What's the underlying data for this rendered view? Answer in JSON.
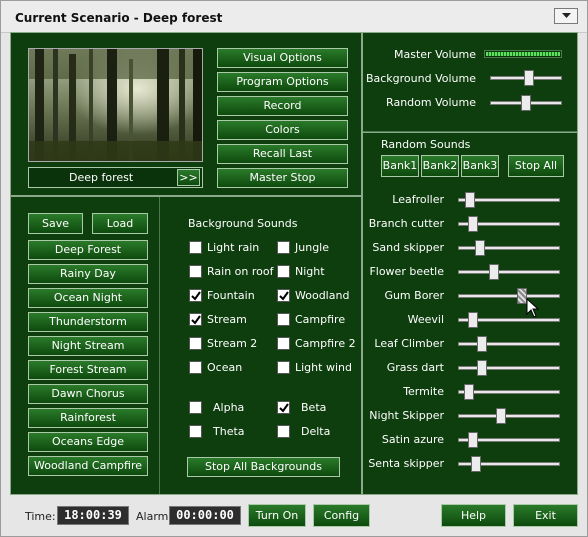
{
  "title": "Current Scenario - Deep forest",
  "scene": {
    "name": "Deep forest",
    "next_label": ">>"
  },
  "option_buttons": [
    "Visual Options",
    "Program Options",
    "Record",
    "Colors",
    "Recall Last",
    "Master Stop"
  ],
  "volume": {
    "master_label": "Master Volume",
    "master_level": 1.0,
    "background_label": "Background Volume",
    "background_level": 0.55,
    "random_label": "Random Volume",
    "random_level": 0.5
  },
  "random_sounds": {
    "heading": "Random Sounds",
    "banks": [
      "Bank1",
      "Bank2",
      "Bank3"
    ],
    "stop_all": "Stop All",
    "items": [
      {
        "label": "Leafroller",
        "level": 0.08
      },
      {
        "label": "Branch cutter",
        "level": 0.11
      },
      {
        "label": "Sand skipper",
        "level": 0.19
      },
      {
        "label": "Flower beetle",
        "level": 0.34
      },
      {
        "label": "Gum Borer",
        "level": 0.64
      },
      {
        "label": "Weevil",
        "level": 0.11
      },
      {
        "label": "Leaf Climber",
        "level": 0.21
      },
      {
        "label": "Grass dart",
        "level": 0.21
      },
      {
        "label": "Termite",
        "level": 0.07
      },
      {
        "label": "Night Skipper",
        "level": 0.41
      },
      {
        "label": "Satin azure",
        "level": 0.11
      },
      {
        "label": "Senta skipper",
        "level": 0.14
      }
    ]
  },
  "presets": {
    "save": "Save",
    "load": "Load",
    "items": [
      "Deep Forest",
      "Rainy Day",
      "Ocean Night",
      "Thunderstorm",
      "Night Stream",
      "Forest Stream",
      "Dawn Chorus",
      "Rainforest",
      "Oceans Edge",
      "Woodland Campfire"
    ]
  },
  "background_sounds": {
    "heading": "Background Sounds",
    "items": [
      {
        "label": "Light rain",
        "checked": false
      },
      {
        "label": "Jungle",
        "checked": false
      },
      {
        "label": "Rain on roof",
        "checked": false
      },
      {
        "label": "Night",
        "checked": false
      },
      {
        "label": "Fountain",
        "checked": true
      },
      {
        "label": "Woodland",
        "checked": true
      },
      {
        "label": "Stream",
        "checked": true
      },
      {
        "label": "Campfire",
        "checked": false
      },
      {
        "label": "Stream 2",
        "checked": false
      },
      {
        "label": "Campfire 2",
        "checked": false
      },
      {
        "label": "Ocean",
        "checked": false
      },
      {
        "label": "Light wind",
        "checked": false
      }
    ],
    "waves": [
      {
        "label": "Alpha",
        "checked": false
      },
      {
        "label": "Beta",
        "checked": true
      },
      {
        "label": "Theta",
        "checked": false
      },
      {
        "label": "Delta",
        "checked": false
      }
    ],
    "stop_all": "Stop All Backgrounds"
  },
  "footer": {
    "time_label": "Time:",
    "time_value": "18:00:39",
    "alarm_label": "Alarm:",
    "alarm_value": "00:00:00",
    "turn_on": "Turn On",
    "config": "Config",
    "help": "Help",
    "exit": "Exit"
  }
}
